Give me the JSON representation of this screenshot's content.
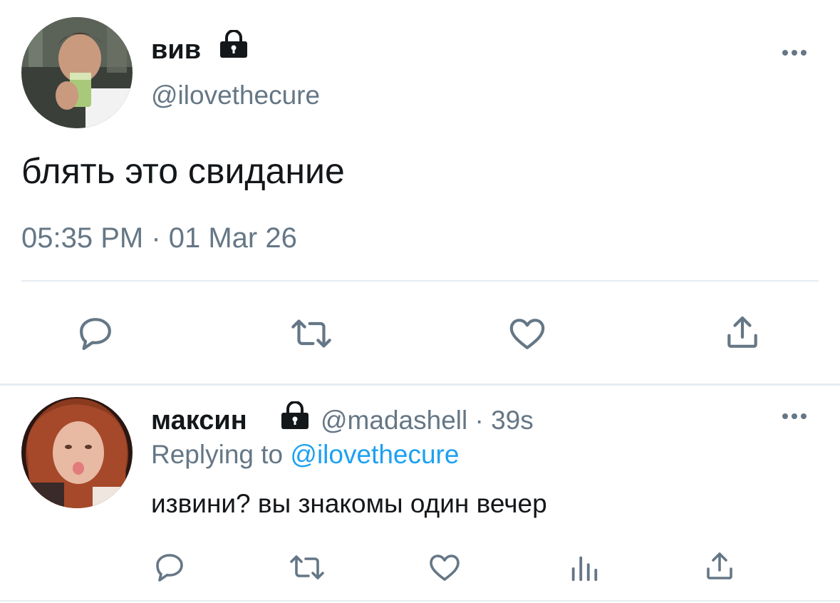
{
  "main_tweet": {
    "display_name": "вив",
    "handle": "@ilovethecure",
    "text": "блять это свидание",
    "timestamp": "05:35 PM · 01 Mar 26",
    "icons": [
      "lock-icon",
      "more-icon",
      "reply-icon",
      "retweet-icon",
      "like-icon",
      "share-icon"
    ]
  },
  "reply_tweet": {
    "display_name": "максин",
    "handle": "@madashell",
    "separator": "·",
    "time_ago": "39s",
    "replying_prefix": "Replying to",
    "replying_handle": "@ilovethecure",
    "text": "извини? вы знакомы один вечер",
    "icons": [
      "lock-icon",
      "more-icon",
      "reply-icon",
      "retweet-icon",
      "like-icon",
      "analytics-icon",
      "share-icon"
    ]
  },
  "colors": {
    "text": "#14171a",
    "secondary": "#657786",
    "link": "#1da1f2",
    "divider": "#e6ecf0"
  }
}
